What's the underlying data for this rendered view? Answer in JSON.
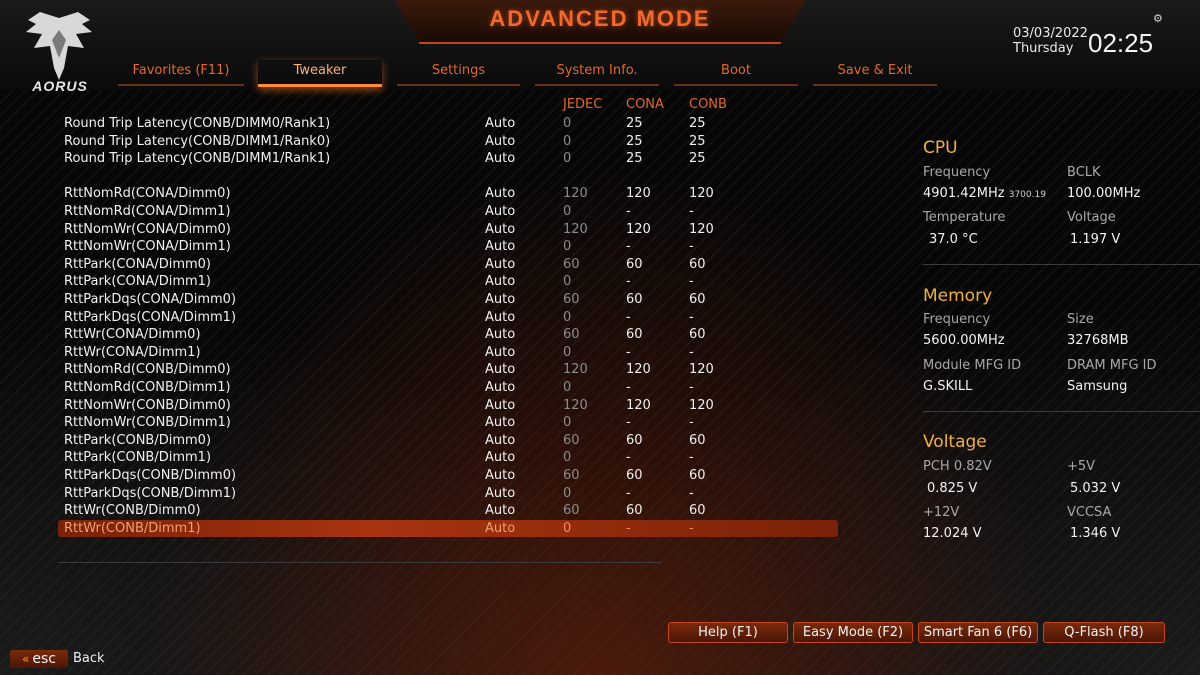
{
  "header": {
    "title": "ADVANCED MODE",
    "logo_text": "AORUS",
    "date": "03/03/2022",
    "day": "Thursday",
    "time": "02:25",
    "settings_icon": "gear-icon"
  },
  "tabs": [
    {
      "label": "Favorites (F11)",
      "active": false
    },
    {
      "label": "Tweaker",
      "active": true
    },
    {
      "label": "Settings",
      "active": false
    },
    {
      "label": "System Info.",
      "active": false
    },
    {
      "label": "Boot",
      "active": false
    },
    {
      "label": "Save & Exit",
      "active": false
    }
  ],
  "table": {
    "columns": [
      "JEDEC",
      "CONA",
      "CONB"
    ],
    "rows": [
      {
        "name": "Round Trip Latency(CONB/DIMM0/Rank1)",
        "value": "Auto",
        "jedec": "0",
        "cona": "25",
        "conb": "25"
      },
      {
        "name": "Round Trip Latency(CONB/DIMM1/Rank0)",
        "value": "Auto",
        "jedec": "0",
        "cona": "25",
        "conb": "25"
      },
      {
        "name": "Round Trip Latency(CONB/DIMM1/Rank1)",
        "value": "Auto",
        "jedec": "0",
        "cona": "25",
        "conb": "25"
      },
      {
        "name": "RttNomRd(CONA/Dimm0)",
        "value": "Auto",
        "jedec": "120",
        "cona": "120",
        "conb": "120"
      },
      {
        "name": "RttNomRd(CONA/Dimm1)",
        "value": "Auto",
        "jedec": "0",
        "cona": "-",
        "conb": "-"
      },
      {
        "name": "RttNomWr(CONA/Dimm0)",
        "value": "Auto",
        "jedec": "120",
        "cona": "120",
        "conb": "120"
      },
      {
        "name": "RttNomWr(CONA/Dimm1)",
        "value": "Auto",
        "jedec": "0",
        "cona": "-",
        "conb": "-"
      },
      {
        "name": "RttPark(CONA/Dimm0)",
        "value": "Auto",
        "jedec": "60",
        "cona": "60",
        "conb": "60"
      },
      {
        "name": "RttPark(CONA/Dimm1)",
        "value": "Auto",
        "jedec": "0",
        "cona": "-",
        "conb": "-"
      },
      {
        "name": "RttParkDqs(CONA/Dimm0)",
        "value": "Auto",
        "jedec": "60",
        "cona": "60",
        "conb": "60"
      },
      {
        "name": "RttParkDqs(CONA/Dimm1)",
        "value": "Auto",
        "jedec": "0",
        "cona": "-",
        "conb": "-"
      },
      {
        "name": "RttWr(CONA/Dimm0)",
        "value": "Auto",
        "jedec": "60",
        "cona": "60",
        "conb": "60"
      },
      {
        "name": "RttWr(CONA/Dimm1)",
        "value": "Auto",
        "jedec": "0",
        "cona": "-",
        "conb": "-"
      },
      {
        "name": "RttNomRd(CONB/Dimm0)",
        "value": "Auto",
        "jedec": "120",
        "cona": "120",
        "conb": "120"
      },
      {
        "name": "RttNomRd(CONB/Dimm1)",
        "value": "Auto",
        "jedec": "0",
        "cona": "-",
        "conb": "-"
      },
      {
        "name": "RttNomWr(CONB/Dimm0)",
        "value": "Auto",
        "jedec": "120",
        "cona": "120",
        "conb": "120"
      },
      {
        "name": "RttNomWr(CONB/Dimm1)",
        "value": "Auto",
        "jedec": "0",
        "cona": "-",
        "conb": "-"
      },
      {
        "name": "RttPark(CONB/Dimm0)",
        "value": "Auto",
        "jedec": "60",
        "cona": "60",
        "conb": "60"
      },
      {
        "name": "RttPark(CONB/Dimm1)",
        "value": "Auto",
        "jedec": "0",
        "cona": "-",
        "conb": "-"
      },
      {
        "name": "RttParkDqs(CONB/Dimm0)",
        "value": "Auto",
        "jedec": "60",
        "cona": "60",
        "conb": "60"
      },
      {
        "name": "RttParkDqs(CONB/Dimm1)",
        "value": "Auto",
        "jedec": "0",
        "cona": "-",
        "conb": "-"
      },
      {
        "name": "RttWr(CONB/Dimm0)",
        "value": "Auto",
        "jedec": "60",
        "cona": "60",
        "conb": "60"
      },
      {
        "name": "RttWr(CONB/Dimm1)",
        "value": "Auto",
        "jedec": "0",
        "cona": "-",
        "conb": "-",
        "selected": true
      }
    ]
  },
  "cpu": {
    "title": "CPU",
    "frequency_label": "Frequency",
    "frequency": "4901.42MHz",
    "frequency_sub": "3700.19",
    "bclk_label": "BCLK",
    "bclk": "100.00MHz",
    "temperature_label": "Temperature",
    "temperature": "37.0 °C",
    "voltage_label": "Voltage",
    "voltage": "1.197 V"
  },
  "memory": {
    "title": "Memory",
    "frequency_label": "Frequency",
    "frequency": "5600.00MHz",
    "size_label": "Size",
    "size": "32768MB",
    "module_mfg_label": "Module MFG ID",
    "module_mfg": "G.SKILL",
    "dram_mfg_label": "DRAM MFG ID",
    "dram_mfg": "Samsung"
  },
  "voltage": {
    "title": "Voltage",
    "pch_label": "PCH 0.82V",
    "pch": "0.825 V",
    "v5_label": "+5V",
    "v5": "5.032 V",
    "v12_label": "+12V",
    "v12": "12.024 V",
    "vccsa_label": "VCCSA",
    "vccsa": "1.346 V"
  },
  "footer": {
    "help": "Help (F1)",
    "easy_mode": "Easy Mode (F2)",
    "smart_fan": "Smart Fan 6 (F6)",
    "qflash": "Q-Flash (F8)",
    "esc": "esc",
    "back": "Back"
  },
  "colors": {
    "accent": "#e0692c",
    "highlight": "#a8340f",
    "section_title": "#f0b040"
  }
}
